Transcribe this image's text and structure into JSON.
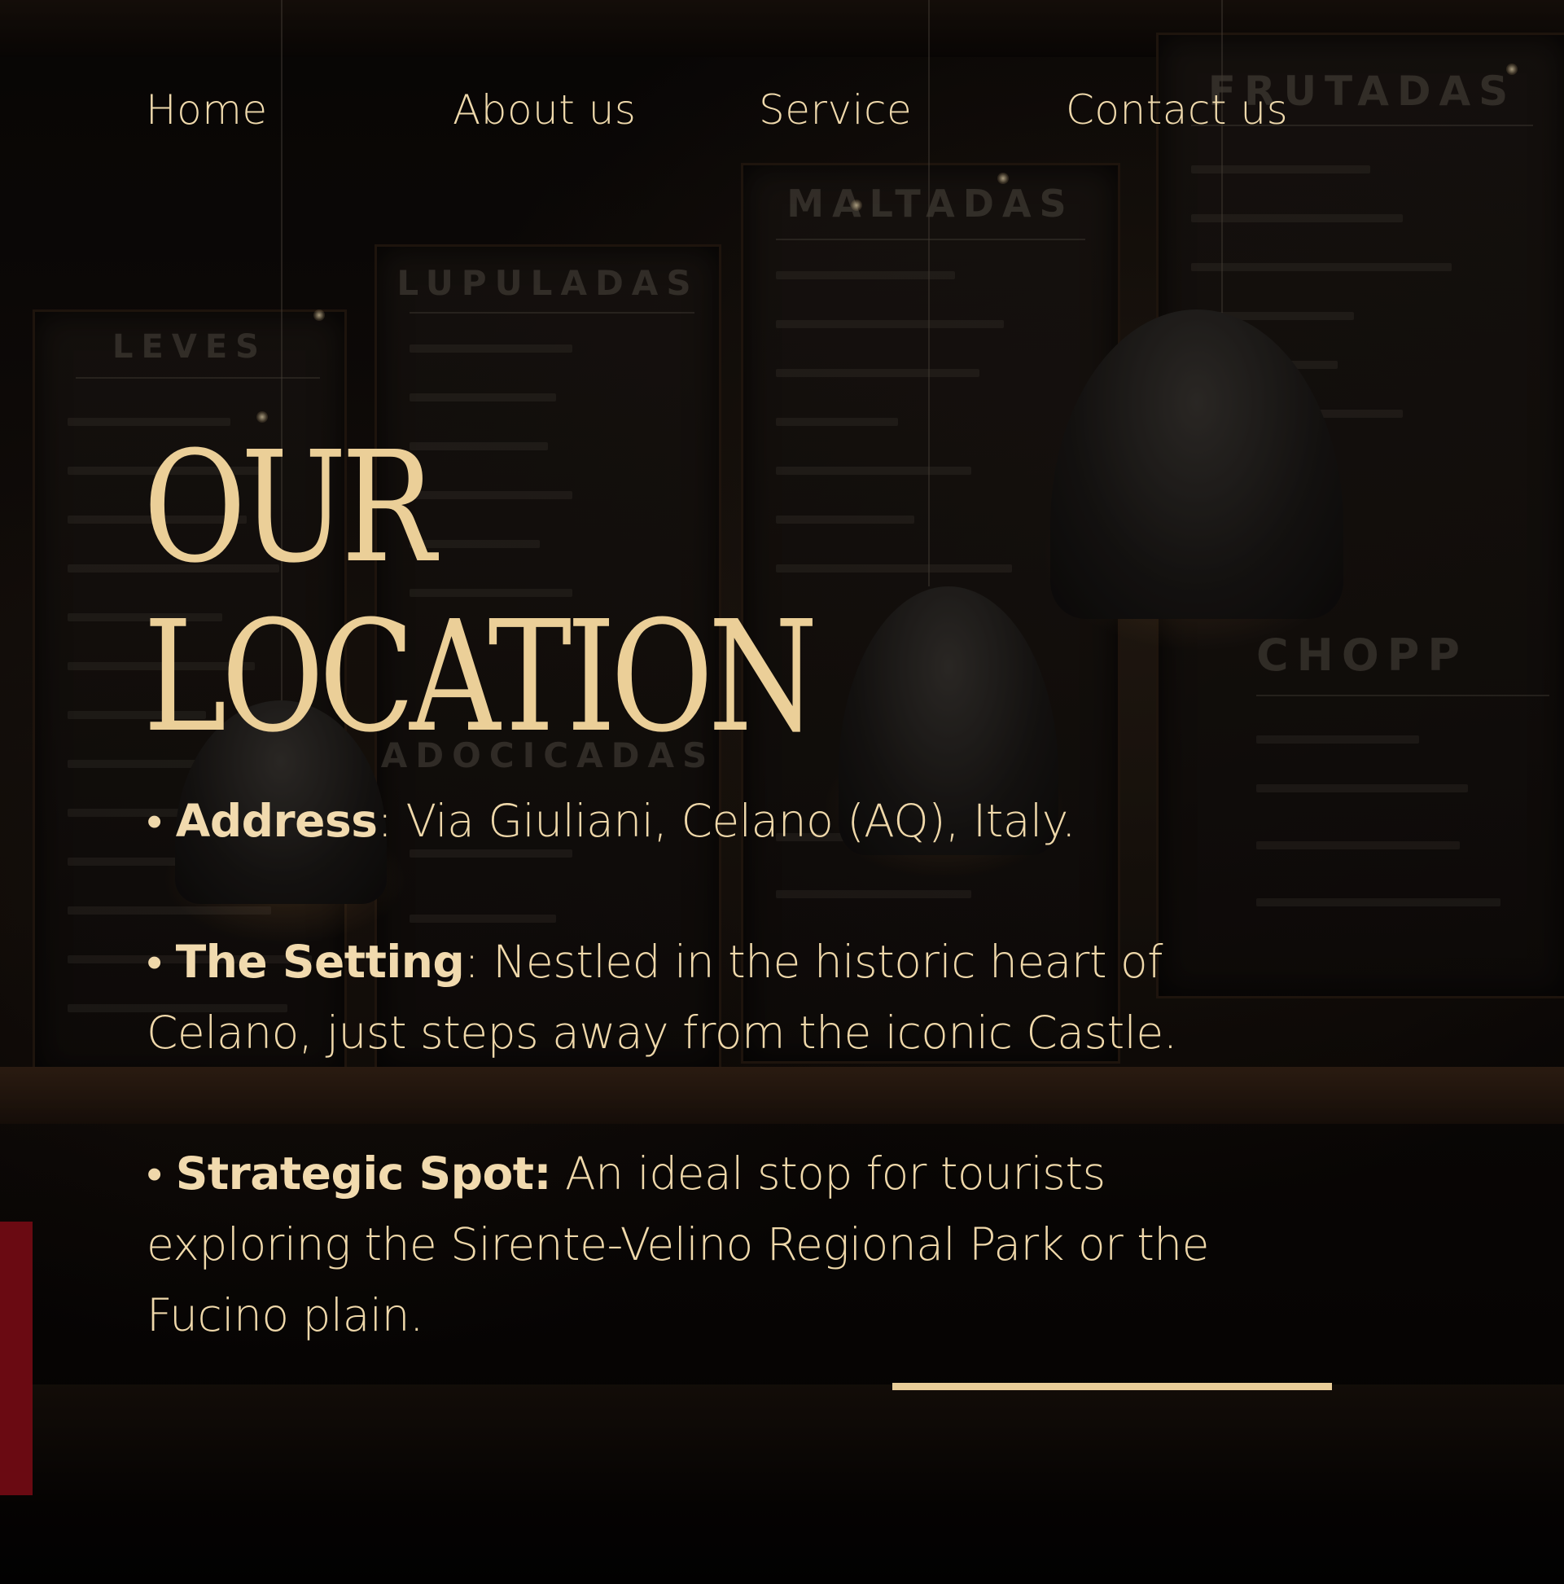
{
  "nav": {
    "home": "Home",
    "about": "About us",
    "service": "Service",
    "contact": "Contact us"
  },
  "heading": {
    "line1": "OUR",
    "line2": "LOCATION"
  },
  "details": [
    {
      "bullet": "•",
      "label": "Address",
      "separator": ":",
      "text": " Via Giuliani, Celano (AQ), Italy."
    },
    {
      "bullet": "•",
      "label": "The Setting",
      "separator": ":",
      "text": " Nestled in the historic heart of Celano, just steps away from the iconic Castle."
    },
    {
      "bullet": "•",
      "label": "Strategic Spot:",
      "separator": "",
      "text": " An ideal stop for tourists exploring the Sirente-Velino Regional Park or the Fucino plain."
    }
  ],
  "background_signage": {
    "boards": [
      "LEVES",
      "LUPULADAS",
      "MALTADAS",
      "FRUTADAS",
      "CHOPP",
      "ADOCICADAS"
    ]
  },
  "colors": {
    "accent": "#ebcf98",
    "text": "#efd8aa",
    "background": "#0a0706",
    "side_bar": "#6a0a12"
  }
}
